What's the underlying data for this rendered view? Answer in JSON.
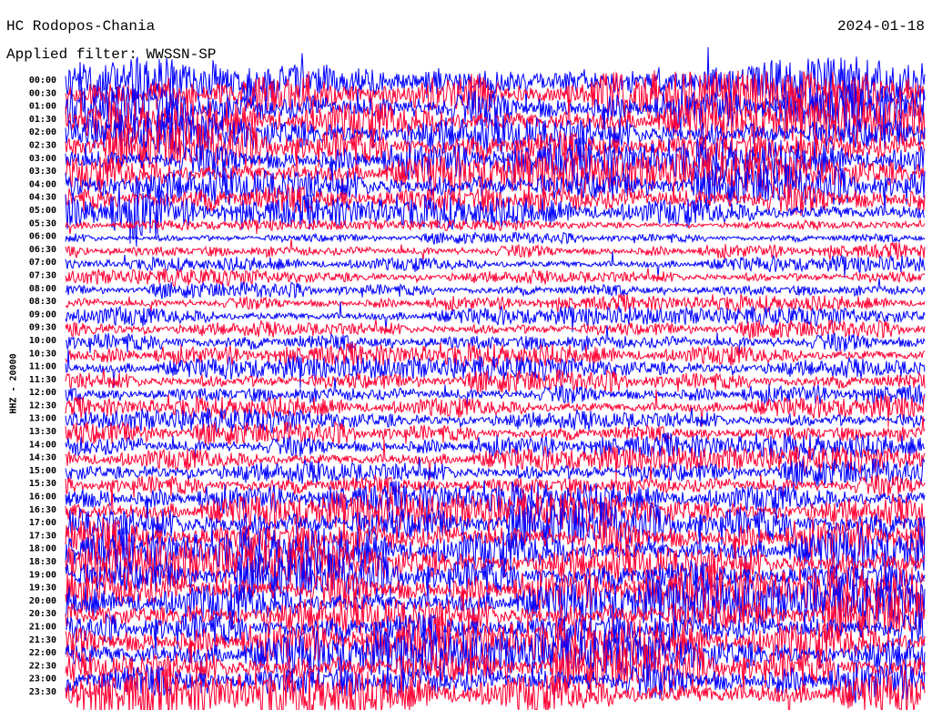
{
  "header": {
    "station": "HC Rodopos-Chania",
    "date": "2024-01-18",
    "filter": "Applied filter: WWSSN-SP"
  },
  "chart_data": {
    "type": "line",
    "title": "HC Rodopos-Chania",
    "ylabel": "HHZ - 20000",
    "row_labels": [
      "00:00",
      "00:30",
      "01:00",
      "01:30",
      "02:00",
      "02:30",
      "03:00",
      "03:30",
      "04:00",
      "04:30",
      "05:00",
      "05:30",
      "06:00",
      "06:30",
      "07:00",
      "07:30",
      "08:00",
      "08:30",
      "09:00",
      "09:30",
      "10:00",
      "10:30",
      "11:00",
      "11:30",
      "12:00",
      "12:30",
      "13:00",
      "13:30",
      "14:00",
      "14:30",
      "15:00",
      "15:30",
      "16:00",
      "16:30",
      "17:00",
      "17:30",
      "18:00",
      "18:30",
      "19:00",
      "19:30",
      "20:00",
      "20:30",
      "21:00",
      "21:30",
      "22:00",
      "22:30",
      "23:00",
      "23:30"
    ],
    "series_colors": [
      "#0000ff",
      "#ff0033"
    ],
    "relative_amplitude": [
      1,
      1,
      1,
      1,
      1,
      1,
      0.9,
      0.9,
      0.9,
      0.9,
      0.7,
      0.22,
      0.25,
      0.35,
      0.35,
      0.35,
      0.35,
      0.35,
      0.4,
      0.4,
      0.5,
      0.5,
      0.5,
      0.5,
      0.5,
      0.5,
      0.5,
      0.5,
      0.55,
      0.55,
      0.6,
      0.6,
      0.7,
      0.8,
      1,
      1,
      1,
      1,
      1,
      1,
      1,
      1,
      1,
      1,
      1,
      1,
      1,
      1
    ]
  }
}
